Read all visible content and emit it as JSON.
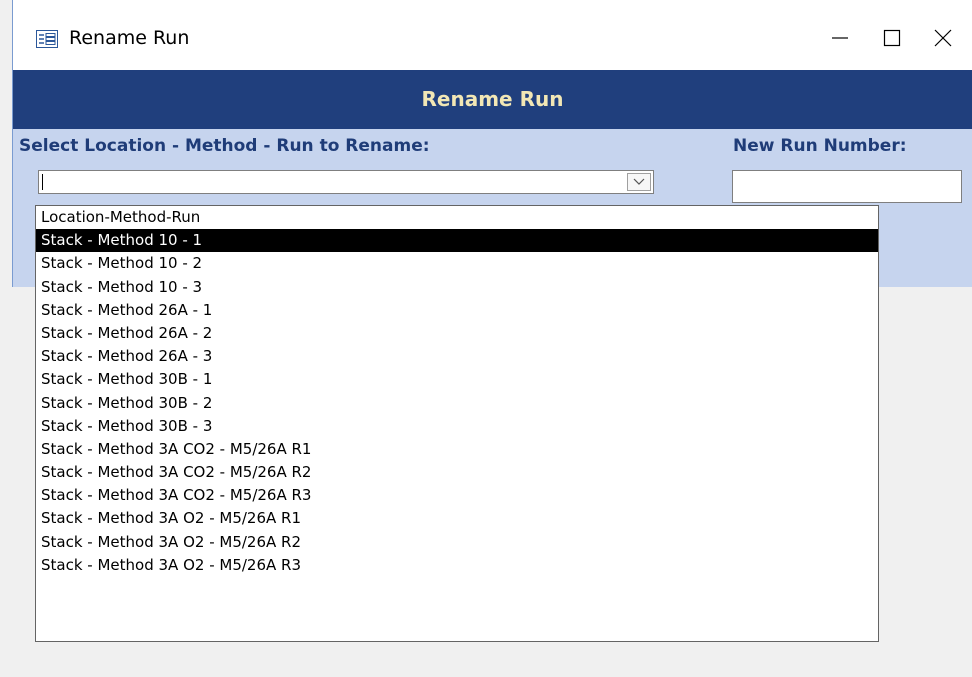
{
  "window": {
    "title": "Rename Run",
    "icon": "form-icon",
    "controls": [
      "minimize-icon",
      "maximize-icon",
      "close-icon"
    ]
  },
  "header": {
    "title": "Rename Run"
  },
  "form": {
    "select_label": "Select Location - Method - Run to Rename:",
    "new_run_label": "New Run Number:",
    "combo_value": "",
    "new_run_value": ""
  },
  "dropdown": {
    "items": [
      "Location-Method-Run",
      "Stack - Method 10 - 1",
      "Stack - Method 10 - 2",
      "Stack - Method 10 - 3",
      "Stack - Method 26A - 1",
      "Stack - Method 26A - 2",
      "Stack - Method 26A - 3",
      "Stack - Method 30B - 1",
      "Stack - Method 30B - 2",
      "Stack - Method 30B - 3",
      "Stack - Method 3A CO2 - M5/26A R1",
      "Stack - Method 3A CO2 - M5/26A R2",
      "Stack - Method 3A CO2 - M5/26A R3",
      "Stack - Method 3A O2 - M5/26A R1",
      "Stack - Method 3A O2 - M5/26A R2",
      "Stack - Method 3A O2 - M5/26A R3"
    ],
    "selected_index": 1
  },
  "colors": {
    "header_band": "#203f7d",
    "header_text": "#f2e7b5",
    "form_body": "#c6d4ee",
    "label_text": "#1f3c78",
    "selection": "#000000"
  }
}
